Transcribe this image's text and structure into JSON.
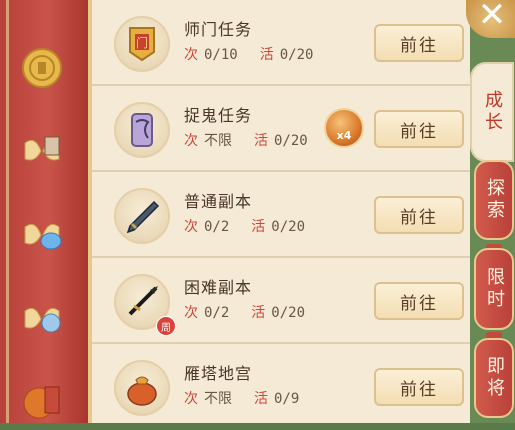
{
  "colors": {
    "sidebar_red": "#c9544a",
    "panel_bg": "#f4ead6",
    "label_red": "#d0453a",
    "button_bg": "#f3deb4",
    "tab_red": "#b9413a"
  },
  "sidebar": {
    "icons": [
      "coin-icon",
      "butterfly-scroll-icon",
      "butterfly-blue-gem-icon",
      "butterfly-blue-orb-icon",
      "treasure-chest-icon"
    ]
  },
  "tasks": [
    {
      "title": "师门任务",
      "count_label": "次",
      "count": "0/10",
      "activity_label": "活",
      "activity": "0/20",
      "button": "前往",
      "icon": "banner-icon"
    },
    {
      "title": "捉鬼任务",
      "count_label": "次",
      "count": "不限",
      "activity_label": "活",
      "activity": "0/20",
      "button": "前往",
      "icon": "ghost-scroll-icon",
      "bonus": "x4"
    },
    {
      "title": "普通副本",
      "count_label": "次",
      "count": "0/2",
      "activity_label": "活",
      "activity": "0/20",
      "button": "前往",
      "icon": "sword-icon"
    },
    {
      "title": "困难副本",
      "count_label": "次",
      "count": "0/2",
      "activity_label": "活",
      "activity": "0/20",
      "button": "前往",
      "icon": "dark-weapon-icon",
      "badge": "周"
    },
    {
      "title": "雁塔地宫",
      "count_label": "次",
      "count": "不限",
      "activity_label": "活",
      "activity": "0/9",
      "button": "前往",
      "icon": "treasure-bag-icon"
    }
  ],
  "tabs": [
    {
      "label": "成长",
      "active": true
    },
    {
      "label": "探索",
      "active": false
    },
    {
      "label": "限时",
      "active": false
    },
    {
      "label": "即将",
      "active": false
    }
  ],
  "close": "✕"
}
